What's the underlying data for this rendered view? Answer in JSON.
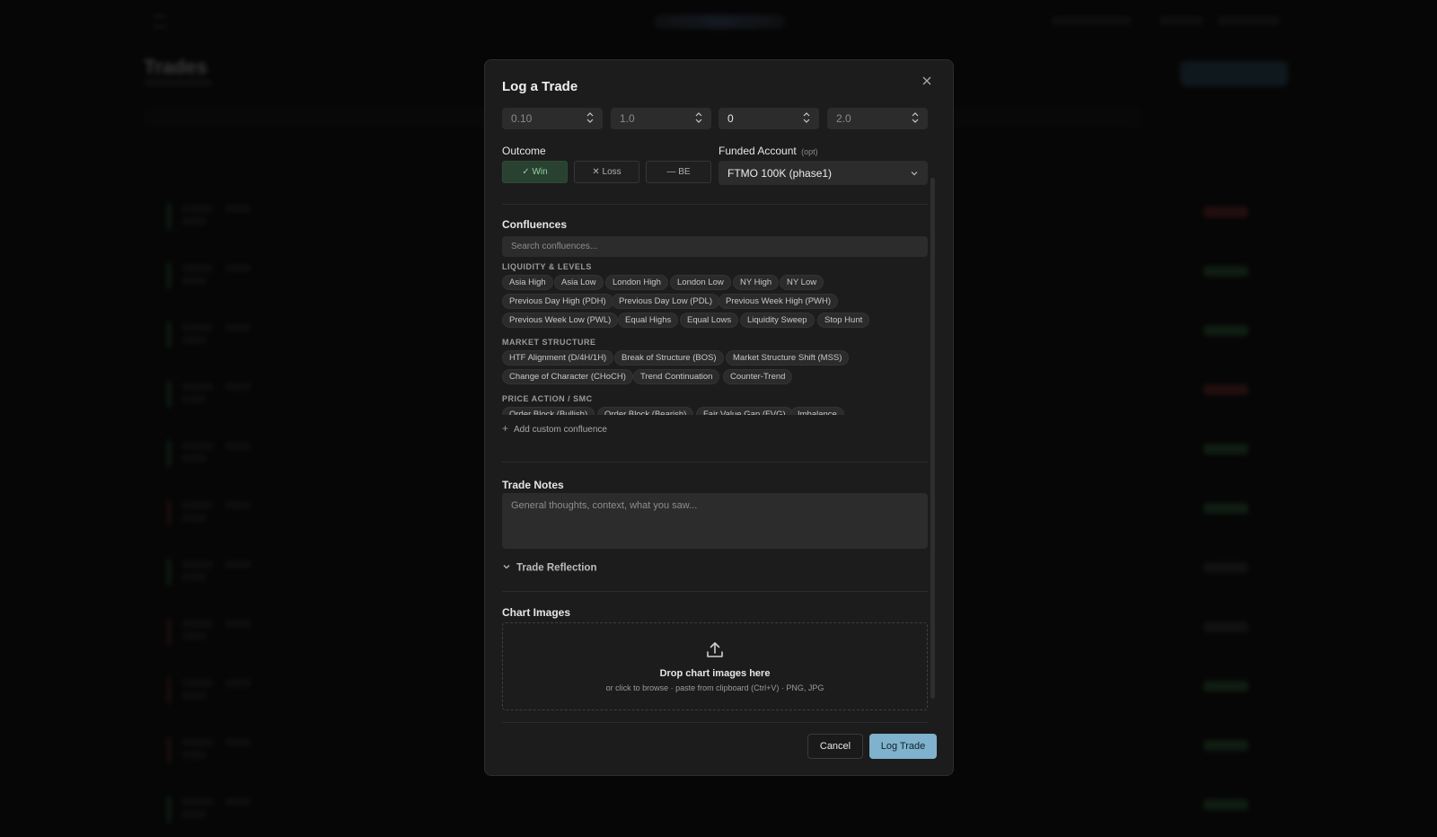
{
  "modal": {
    "title": "Log a Trade",
    "close_icon": "close-icon",
    "number_fields": [
      {
        "value": "0.10",
        "placeholder": true
      },
      {
        "value": "1.0",
        "placeholder": true
      },
      {
        "value": "0",
        "placeholder": false
      },
      {
        "value": "2.0",
        "placeholder": true
      }
    ],
    "outcome": {
      "label": "Outcome",
      "options": [
        "✓ Win",
        "✕ Loss",
        "— BE"
      ],
      "selected": "✓ Win"
    },
    "funded_account": {
      "label": "Funded Account",
      "optional_tag": "(opt)",
      "value": "FTMO 100K (phase1)"
    },
    "confluences": {
      "title": "Confluences",
      "search_placeholder": "Search confluences...",
      "categories": [
        {
          "name": "LIQUIDITY & LEVELS",
          "chips": [
            "Asia High",
            "Asia Low",
            "London High",
            "London Low",
            "NY High",
            "NY Low",
            "Previous Day High (PDH)",
            "Previous Day Low (PDL)",
            "Previous Week High (PWH)",
            "Previous Week Low (PWL)",
            "Equal Highs",
            "Equal Lows",
            "Liquidity Sweep",
            "Stop Hunt"
          ]
        },
        {
          "name": "MARKET STRUCTURE",
          "chips": [
            "HTF Alignment (D/4H/1H)",
            "Break of Structure (BOS)",
            "Market Structure Shift (MSS)",
            "Change of Character (CHoCH)",
            "Trend Continuation",
            "Counter-Trend"
          ]
        },
        {
          "name": "PRICE ACTION / SMC",
          "chips": [
            "Order Block (Bullish)",
            "Order Block (Bearish)",
            "Fair Value Gap (FVG)",
            "Imbalance"
          ]
        }
      ],
      "add_custom": "Add custom confluence"
    },
    "notes": {
      "title": "Trade Notes",
      "placeholder": "General thoughts, context, what you saw..."
    },
    "reflection": {
      "label": "Trade Reflection"
    },
    "chart_images": {
      "title": "Chart Images",
      "drop_title": "Drop chart images here",
      "drop_sub": "or click to browse · paste from clipboard (Ctrl+V) · PNG, JPG"
    },
    "footer": {
      "cancel": "Cancel",
      "submit": "Log Trade"
    }
  },
  "background": {
    "page_title": "Trades"
  },
  "colors": {
    "accent": "#7fb2cc",
    "win_bg": "#294130",
    "win_text": "#8fd39f",
    "modal_bg": "#1c1c1c"
  }
}
